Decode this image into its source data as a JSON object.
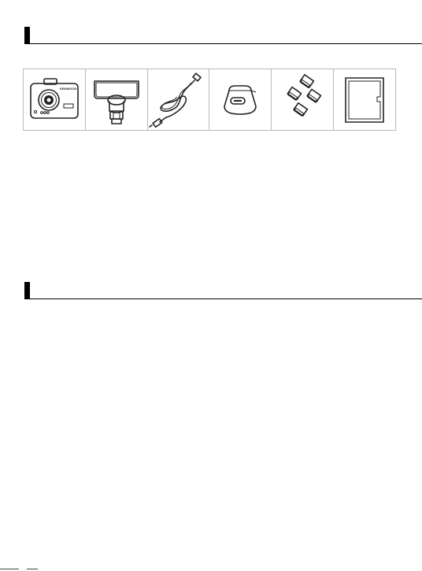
{
  "sections": [
    {
      "title": ""
    },
    {
      "title": ""
    }
  ],
  "accessories": {
    "items": [
      {
        "icon": "dash-camera-icon",
        "brand_text": "KENWOOD"
      },
      {
        "icon": "mount-bracket-icon"
      },
      {
        "icon": "usb-cable-icon"
      },
      {
        "icon": "car-charger-icon"
      },
      {
        "icon": "adhesive-pads-icon"
      },
      {
        "icon": "memory-card-icon"
      }
    ]
  }
}
